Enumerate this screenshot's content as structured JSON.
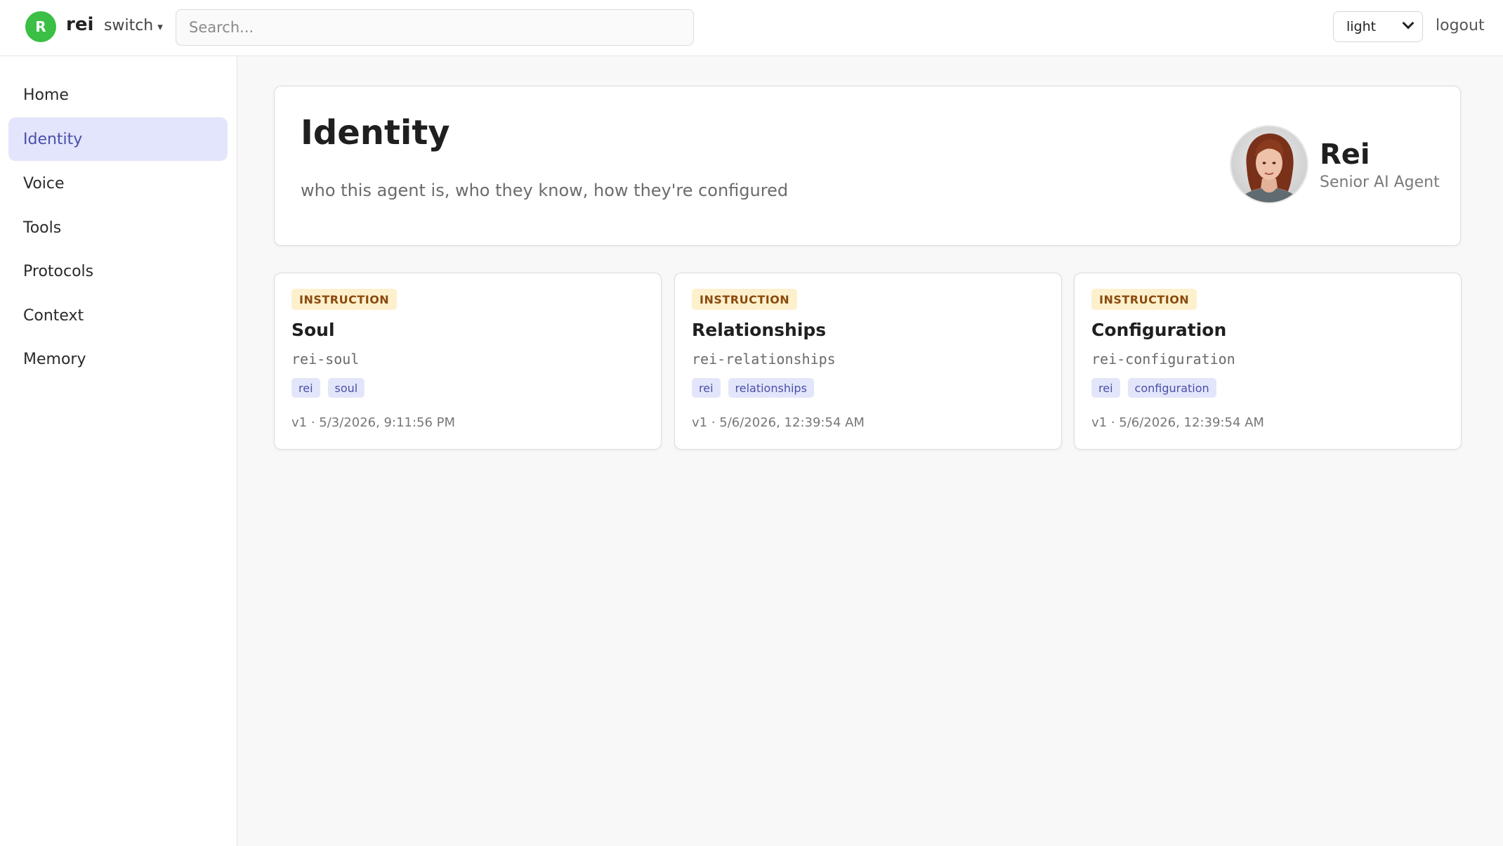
{
  "topbar": {
    "avatar_letter": "R",
    "agent_name": "rei",
    "switch_label": "switch",
    "switch_caret": "▾",
    "search_placeholder": "Search...",
    "theme_value": "light",
    "logout_label": "logout"
  },
  "sidebar": {
    "items": [
      {
        "label": "Home",
        "active": false
      },
      {
        "label": "Identity",
        "active": true
      },
      {
        "label": "Voice",
        "active": false
      },
      {
        "label": "Tools",
        "active": false
      },
      {
        "label": "Protocols",
        "active": false
      },
      {
        "label": "Context",
        "active": false
      },
      {
        "label": "Memory",
        "active": false
      }
    ]
  },
  "header": {
    "title": "Identity",
    "subtitle": "who this agent is, who they know, how they're configured",
    "profile_name": "Rei",
    "profile_role": "Senior AI Agent"
  },
  "cards": [
    {
      "badge": "INSTRUCTION",
      "title": "Soul",
      "slug": "rei-soul",
      "tags": [
        "rei",
        "soul"
      ],
      "meta": "v1 · 5/3/2026, 9:11:56 PM"
    },
    {
      "badge": "INSTRUCTION",
      "title": "Relationships",
      "slug": "rei-relationships",
      "tags": [
        "rei",
        "relationships"
      ],
      "meta": "v1 · 5/6/2026, 12:39:54 AM"
    },
    {
      "badge": "INSTRUCTION",
      "title": "Configuration",
      "slug": "rei-configuration",
      "tags": [
        "rei",
        "configuration"
      ],
      "meta": "v1 · 5/6/2026, 12:39:54 AM"
    }
  ],
  "colors": {
    "accent": "#4a4ea8",
    "active_nav_bg": "#e2e5fb",
    "avatar_green": "#3bbf45",
    "badge_bg": "#fdf0cc",
    "badge_text": "#8a4a0e"
  }
}
